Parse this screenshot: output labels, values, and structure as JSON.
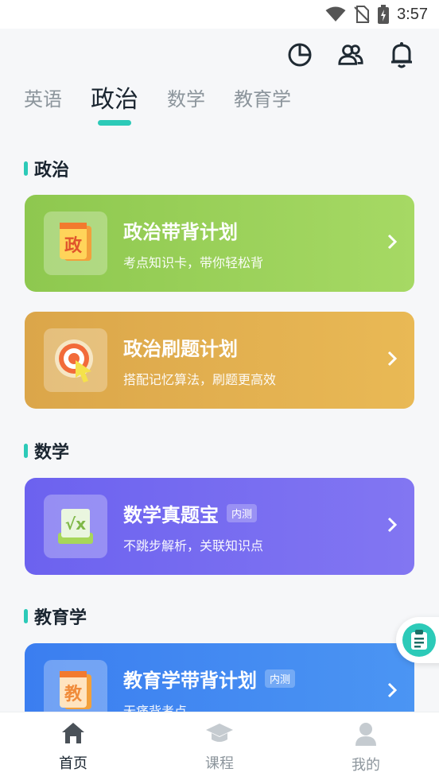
{
  "status_bar": {
    "time": "3:57"
  },
  "top_icons": [
    "pie-chart-icon",
    "users-icon",
    "bell-icon"
  ],
  "tabs": [
    {
      "label": "英语",
      "active": false
    },
    {
      "label": "政治",
      "active": true
    },
    {
      "label": "数学",
      "active": false
    },
    {
      "label": "教育学",
      "active": false
    }
  ],
  "sections": [
    {
      "title": "政治",
      "cards": [
        {
          "title": "政治带背计划",
          "subtitle": "考点知识卡，带你轻松背",
          "icon_text": "政",
          "badge": ""
        },
        {
          "title": "政治刷题计划",
          "subtitle": "搭配记忆算法，刷题更高效",
          "badge": ""
        }
      ]
    },
    {
      "title": "数学",
      "cards": [
        {
          "title": "数学真题宝",
          "subtitle": "不跳步解析，关联知识点",
          "icon_text": "√x",
          "badge": "内测"
        }
      ]
    },
    {
      "title": "教育学",
      "cards": [
        {
          "title": "教育学带背计划",
          "subtitle": "无痛背考点",
          "icon_text": "教",
          "badge": "内测"
        }
      ]
    }
  ],
  "bottom_nav": [
    {
      "label": "首页",
      "active": true
    },
    {
      "label": "课程",
      "active": false
    },
    {
      "label": "我的",
      "active": false
    }
  ],
  "colors": {
    "accent": "#2ccab8",
    "green": "#98cf5a",
    "orange": "#e2b04f",
    "purple": "#766cf0",
    "blue": "#428af2"
  }
}
